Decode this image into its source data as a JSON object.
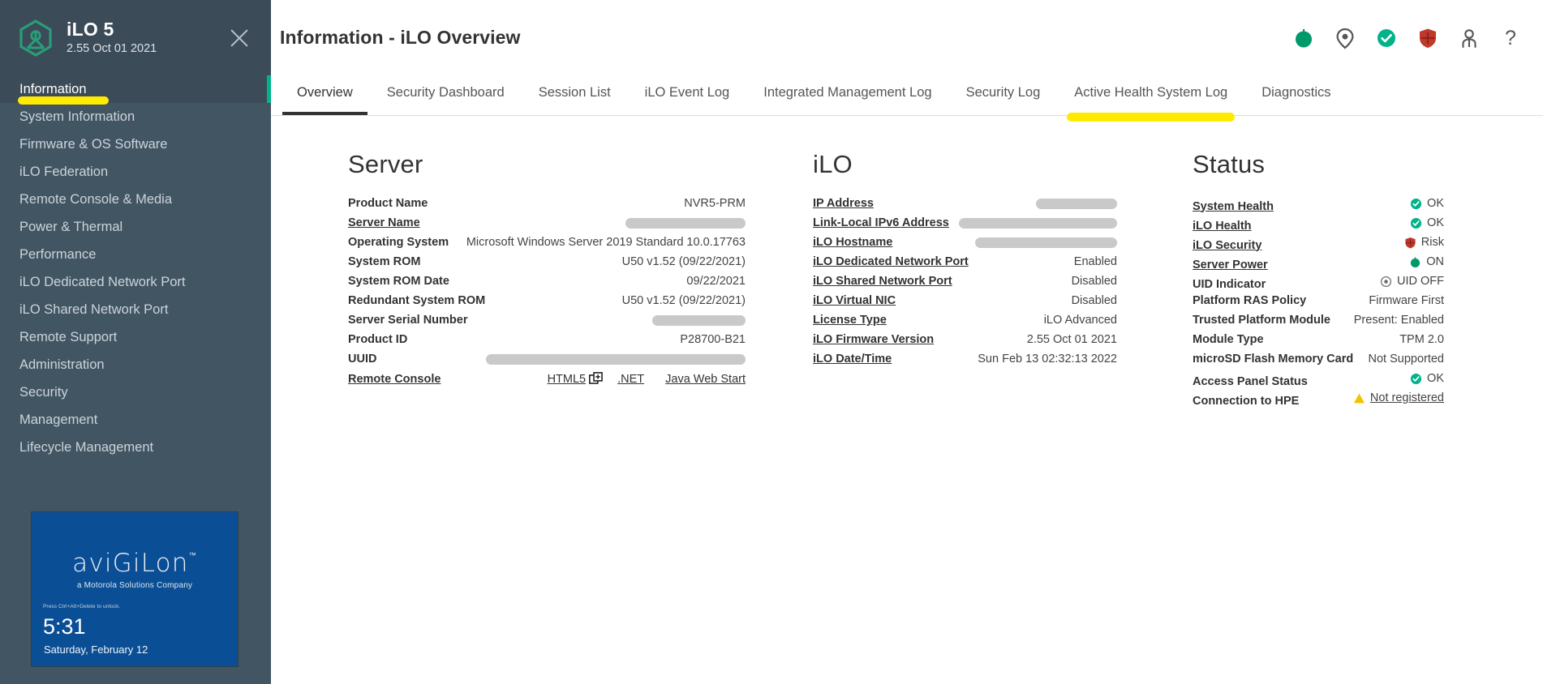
{
  "sidebar": {
    "product": "iLO 5",
    "version": "2.55 Oct 01 2021",
    "close_label": "Close",
    "items": [
      {
        "label": "Information",
        "active": true,
        "highlighted": true
      },
      {
        "label": "System Information",
        "active": false,
        "highlighted": false
      },
      {
        "label": "Firmware & OS Software",
        "active": false,
        "highlighted": false
      },
      {
        "label": "iLO Federation",
        "active": false,
        "highlighted": false
      },
      {
        "label": "Remote Console & Media",
        "active": false,
        "highlighted": false
      },
      {
        "label": "Power & Thermal",
        "active": false,
        "highlighted": false
      },
      {
        "label": "Performance",
        "active": false,
        "highlighted": false
      },
      {
        "label": "iLO Dedicated Network Port",
        "active": false,
        "highlighted": false
      },
      {
        "label": "iLO Shared Network Port",
        "active": false,
        "highlighted": false
      },
      {
        "label": "Remote Support",
        "active": false,
        "highlighted": false
      },
      {
        "label": "Administration",
        "active": false,
        "highlighted": false
      },
      {
        "label": "Security",
        "active": false,
        "highlighted": false
      },
      {
        "label": "Management",
        "active": false,
        "highlighted": false
      },
      {
        "label": "Lifecycle Management",
        "active": false,
        "highlighted": false
      }
    ],
    "console_preview": {
      "brand": "aviGiLon",
      "brand_tm": "™",
      "tagline": "a Motorola Solutions Company",
      "press_note": "Press Ctrl+Alt+Delete to unlock.",
      "time": "5:31",
      "date": "Saturday, February 12",
      "bg_color": "#0a4e96"
    }
  },
  "header": {
    "title": "Information - iLO Overview",
    "icons": [
      {
        "name": "server-power-icon",
        "label": "Server Power"
      },
      {
        "name": "uid-indicator-icon",
        "label": "UID Indicator"
      },
      {
        "name": "health-ok-icon",
        "label": "System Health OK"
      },
      {
        "name": "security-risk-shield-icon",
        "label": "iLO Security Risk"
      },
      {
        "name": "user-account-icon",
        "label": "User"
      },
      {
        "name": "help-question-icon",
        "label": "Help"
      }
    ]
  },
  "tabs": [
    {
      "label": "Overview",
      "active": true,
      "highlighted": false
    },
    {
      "label": "Security Dashboard",
      "active": false,
      "highlighted": false
    },
    {
      "label": "Session List",
      "active": false,
      "highlighted": false
    },
    {
      "label": "iLO Event Log",
      "active": false,
      "highlighted": false
    },
    {
      "label": "Integrated Management Log",
      "active": false,
      "highlighted": false
    },
    {
      "label": "Security Log",
      "active": false,
      "highlighted": false
    },
    {
      "label": "Active Health System Log",
      "active": false,
      "highlighted": true
    },
    {
      "label": "Diagnostics",
      "active": false,
      "highlighted": false
    }
  ],
  "server": {
    "title": "Server",
    "rows": [
      {
        "key": "Product Name",
        "value": "NVR5-PRM",
        "link": false,
        "redacted": false
      },
      {
        "key": "Server Name",
        "value": "",
        "link": true,
        "redacted": true,
        "redact_width": 148
      },
      {
        "key": "Operating System",
        "value": "Microsoft Windows Server 2019 Standard 10.0.17763",
        "link": false,
        "redacted": false
      },
      {
        "key": "System ROM",
        "value": "U50 v1.52 (09/22/2021)",
        "link": false,
        "redacted": false
      },
      {
        "key": "System ROM Date",
        "value": "09/22/2021",
        "link": false,
        "redacted": false
      },
      {
        "key": "Redundant System ROM",
        "value": "U50 v1.52 (09/22/2021)",
        "link": false,
        "redacted": false
      },
      {
        "key": "Server Serial Number",
        "value": "",
        "link": false,
        "redacted": true,
        "redact_width": 115
      },
      {
        "key": "Product ID",
        "value": "P28700-B21",
        "link": false,
        "redacted": false
      },
      {
        "key": "UUID",
        "value": "",
        "link": false,
        "redacted": true,
        "redact_width": 320
      }
    ],
    "remote_console": {
      "key": "Remote Console",
      "html5": "HTML5",
      "dotnet": ".NET",
      "java": "Java Web Start",
      "popout_icon": "open-in-new-window-icon"
    }
  },
  "ilo": {
    "title": "iLO",
    "rows": [
      {
        "key": "IP Address",
        "value": "",
        "link": true,
        "redacted": true,
        "redact_width": 100
      },
      {
        "key": "Link-Local IPv6 Address",
        "value": "",
        "link": true,
        "redacted": true,
        "redact_width": 195
      },
      {
        "key": "iLO Hostname",
        "value": "",
        "link": true,
        "redacted": true,
        "redact_width": 175
      },
      {
        "key": "iLO Dedicated Network Port",
        "value": "Enabled",
        "link": true,
        "redacted": false
      },
      {
        "key": "iLO Shared Network Port",
        "value": "Disabled",
        "link": true,
        "redacted": false
      },
      {
        "key": "iLO Virtual NIC",
        "value": "Disabled",
        "link": true,
        "redacted": false
      },
      {
        "key": "License Type",
        "value": "iLO Advanced",
        "link": true,
        "redacted": false
      },
      {
        "key": "iLO Firmware Version",
        "value": "2.55 Oct 01 2021",
        "link": true,
        "redacted": false
      },
      {
        "key": "iLO Date/Time",
        "value": "Sun Feb 13 02:32:13 2022",
        "link": true,
        "redacted": false
      }
    ]
  },
  "status": {
    "title": "Status",
    "rows": [
      {
        "key": "System Health",
        "value": "OK",
        "link": true,
        "icon": "ok-check-icon"
      },
      {
        "key": "iLO Health",
        "value": "OK",
        "link": true,
        "icon": "ok-check-icon"
      },
      {
        "key": "iLO Security",
        "value": "Risk",
        "link": true,
        "icon": "risk-shield-icon"
      },
      {
        "key": "Server Power",
        "value": "ON",
        "link": true,
        "icon": "power-on-dot-icon"
      },
      {
        "key": "UID Indicator",
        "value": "UID OFF",
        "link": false,
        "icon": "uid-off-icon"
      },
      {
        "key": "Platform RAS Policy",
        "value": "Firmware First",
        "link": false,
        "icon": null
      },
      {
        "key": "Trusted Platform Module",
        "value": "Present: Enabled",
        "link": false,
        "icon": null
      },
      {
        "key": "Module Type",
        "value": "TPM 2.0",
        "link": false,
        "icon": null
      },
      {
        "key": "microSD Flash Memory Card",
        "value": "Not Supported",
        "link": false,
        "icon": null
      },
      {
        "key": "Access Panel Status",
        "value": "OK",
        "link": false,
        "icon": "ok-check-icon"
      },
      {
        "key": "Connection to HPE",
        "value": "Not registered",
        "link": false,
        "icon": "warning-triangle-icon",
        "value_link": true
      }
    ]
  },
  "colors": {
    "sidebar_bg": "#425563",
    "sidebar_header_bg": "#3b4b58",
    "accent_green": "#00b388",
    "highlight_yellow": "#ffeb00",
    "risk_red": "#c0392b",
    "warning_amber": "#f4c300",
    "avigilon_blue": "#0a4e96"
  }
}
